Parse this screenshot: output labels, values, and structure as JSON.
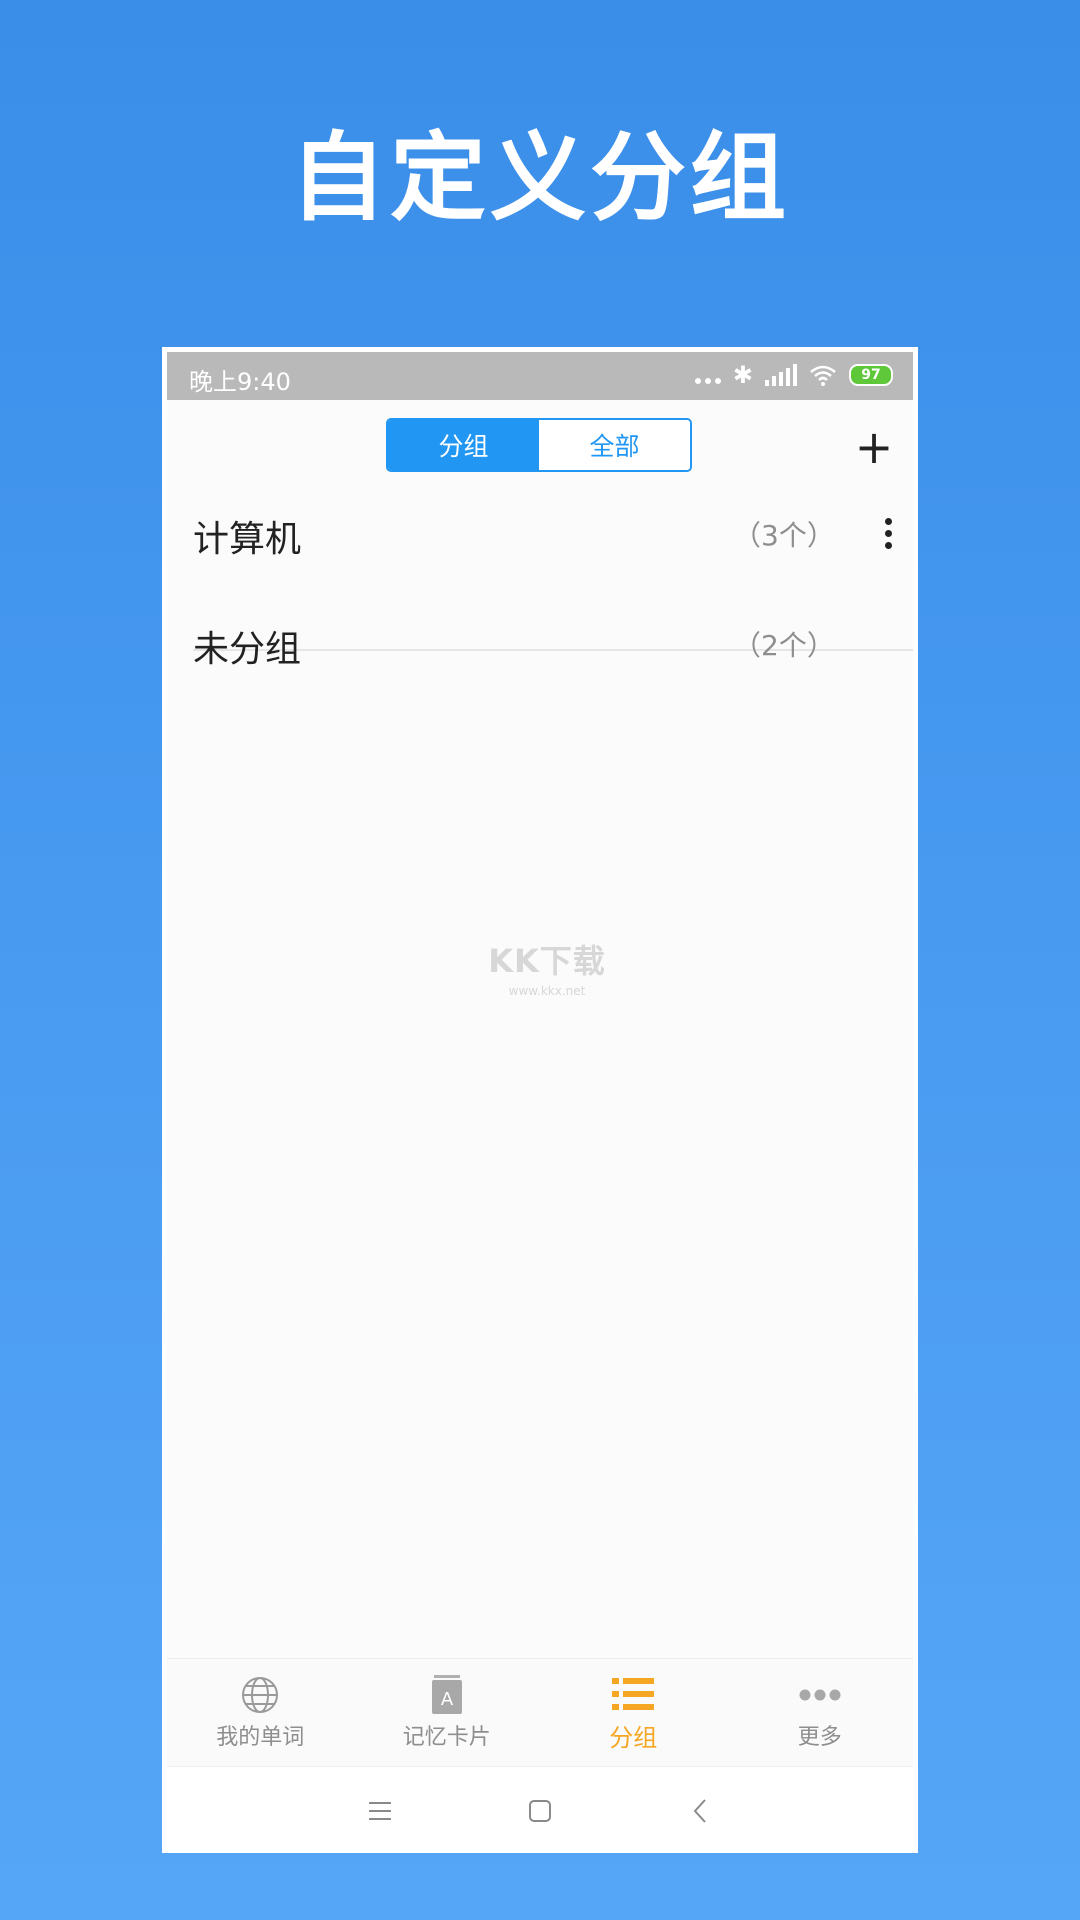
{
  "headline": "自定义分组",
  "status_bar": {
    "time": "晚上9:40",
    "battery_level": "97"
  },
  "header": {
    "segments": [
      {
        "label": "分组",
        "active": true
      },
      {
        "label": "全部",
        "active": false
      }
    ],
    "add_label": "+"
  },
  "groups": [
    {
      "name": "计算机",
      "count": "（3个）",
      "has_menu": true
    },
    {
      "name": "未分组",
      "count": "（2个）",
      "has_menu": false
    }
  ],
  "watermark": {
    "logo": "KK下载",
    "url": "www.kkx.net"
  },
  "tabbar": {
    "items": [
      {
        "label": "我的单词",
        "icon": "globe-icon",
        "active": false
      },
      {
        "label": "记忆卡片",
        "icon": "flashcard-icon",
        "active": false
      },
      {
        "label": "分组",
        "icon": "list-icon",
        "active": true
      },
      {
        "label": "更多",
        "icon": "more-dots-icon",
        "active": false
      }
    ]
  },
  "navbar": {
    "items": [
      "menu-icon",
      "home-icon",
      "back-icon"
    ]
  },
  "colors": {
    "accent_blue": "#2196f3",
    "active_tab": "#f5a623",
    "background_blue": "#3a8ee8"
  }
}
